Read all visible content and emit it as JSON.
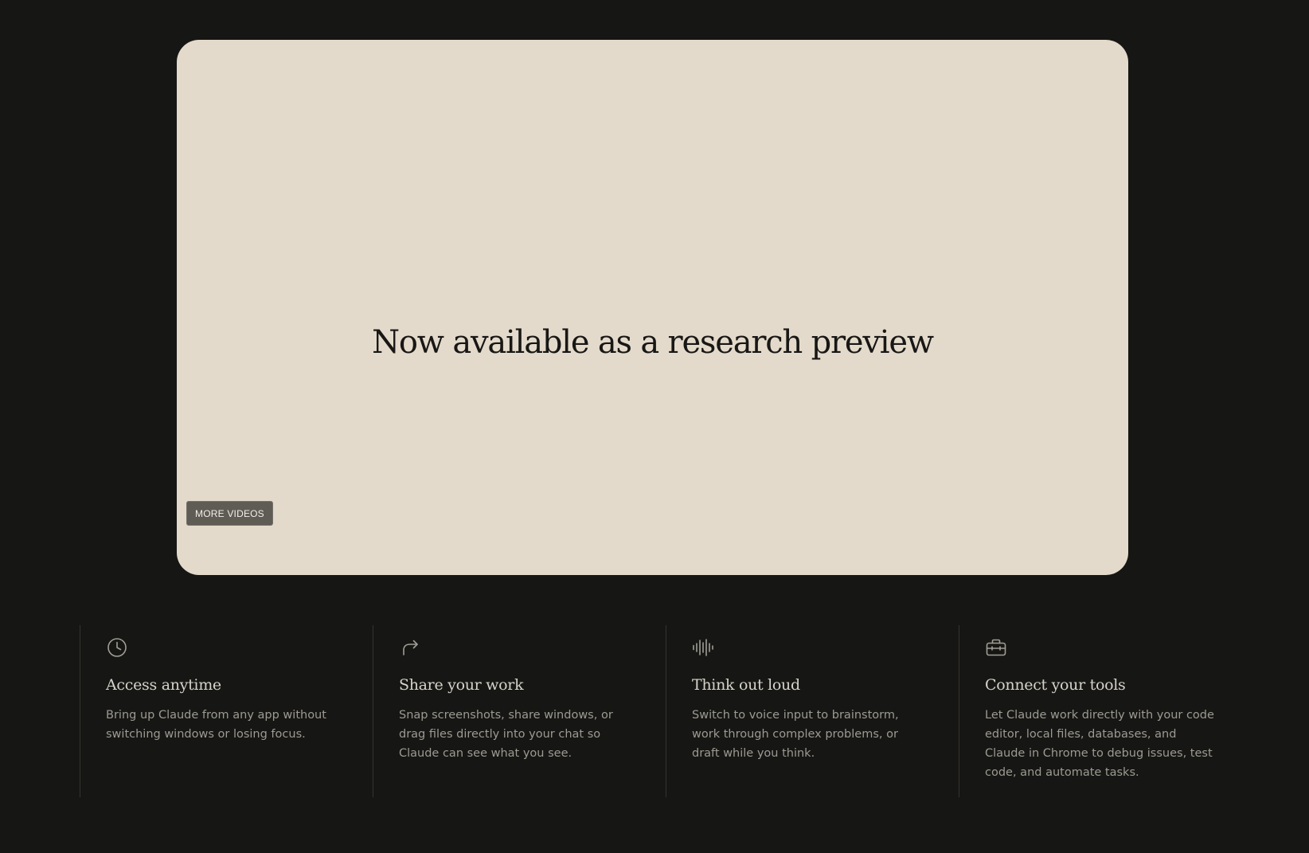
{
  "video": {
    "headline": "Now available as a research preview",
    "more_videos_label": "MORE VIDEOS"
  },
  "features": [
    {
      "icon": "clock-icon",
      "title": "Access anytime",
      "description": "Bring up Claude from any app without switching windows or losing focus."
    },
    {
      "icon": "share-arrow-icon",
      "title": "Share your work",
      "description": "Snap screenshots, share windows, or drag files directly into your chat so Claude can see what you see."
    },
    {
      "icon": "voice-waveform-icon",
      "title": "Think out loud",
      "description": "Switch to voice input to brainstorm, work through complex problems, or draft while you think."
    },
    {
      "icon": "toolbox-icon",
      "title": "Connect your tools",
      "description": "Let Claude work directly with your code editor, local files, databases, and Claude in Chrome to debug issues, test code, and automate tasks."
    }
  ],
  "colors": {
    "page_background": "#161614",
    "card_background": "#e3dacb",
    "headline_text": "#181715",
    "feature_title": "#d6d3ca",
    "feature_description": "#9d9a92",
    "divider": "#34332f",
    "button_background": "#5f5b55"
  }
}
